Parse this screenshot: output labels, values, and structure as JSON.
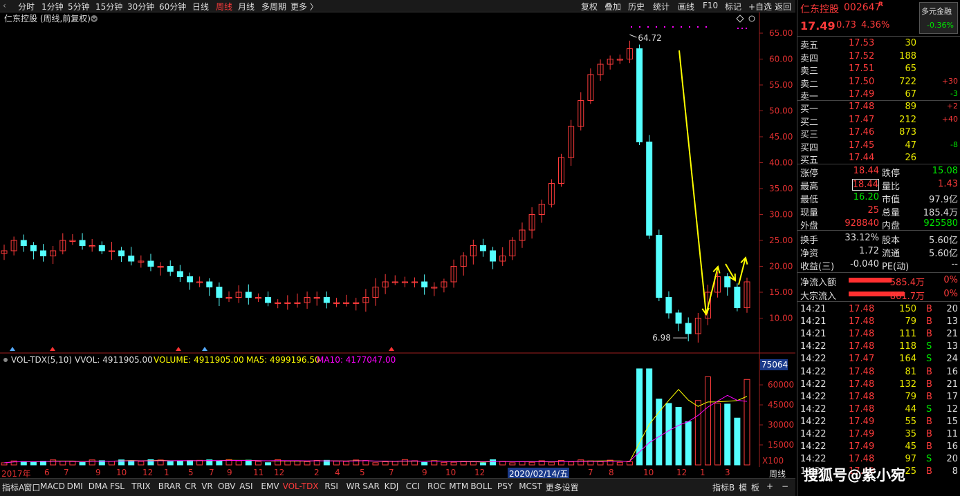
{
  "toolbar": {
    "left": [
      "分时",
      "1分钟",
      "5分钟",
      "15分钟",
      "30分钟",
      "60分钟",
      "日线",
      "周线",
      "月线",
      "多周期",
      "更多 〉"
    ],
    "active": "周线",
    "right": [
      "复权",
      "叠加",
      "历史",
      "统计",
      "画线",
      "F10",
      "标记",
      "+自选",
      "返回"
    ]
  },
  "chart": {
    "title": "仁东控股 (周线,前复权)",
    "high_label": "64.72",
    "low_label": "6.98",
    "price_axis": [
      "65.00",
      "60.00",
      "55.00",
      "50.00",
      "45.00",
      "40.00",
      "35.00",
      "30.00",
      "25.00",
      "20.00",
      "15.00",
      "10.00"
    ],
    "volume_header": {
      "name": "VOL-TDX(5,10)",
      "vvol": "VVOL: 4911905.00",
      "volume": "VOLUME: 4911905.00",
      "ma5": "MA5: 4999196.50",
      "ma10": "MA10: 4177047.00"
    },
    "volume_axis": [
      "75064",
      "60000",
      "45000",
      "30000",
      "15000",
      "X100"
    ],
    "time_axis": [
      "2017年",
      "6",
      "7",
      "9",
      "10",
      "12",
      "1",
      "5",
      "7",
      "9",
      "11",
      "12",
      "2",
      "4",
      "5",
      "7",
      "9",
      "10",
      "12",
      "2020/02/14/五",
      "7",
      "8",
      "10",
      "12",
      "1",
      "3"
    ],
    "time_unit": "周线",
    "colors": {
      "up": "#ff3b3b",
      "down": "#54ffff",
      "ma5": "#ffff00",
      "ma10": "#ff00ff",
      "axis": "#e03030",
      "arrow": "#ffff00"
    }
  },
  "chart_data": {
    "type": "candlestick",
    "title": "仁东控股 (周线,前复权)",
    "period": "weekly",
    "ylim": [
      5,
      67
    ],
    "annotated_high": 64.72,
    "annotated_low": 6.98,
    "close_path": [
      23,
      25,
      24,
      23,
      22,
      23,
      25,
      25,
      24,
      24,
      23,
      23,
      22,
      21,
      21,
      20,
      20,
      19,
      18,
      17,
      17,
      16,
      14,
      14,
      15,
      14,
      14,
      13,
      13,
      13,
      13,
      14,
      14,
      13,
      13,
      13,
      13,
      14,
      16,
      17,
      17,
      17,
      17,
      16,
      16,
      17,
      20,
      22,
      24,
      23,
      21,
      22,
      25,
      27,
      30,
      32,
      36,
      41,
      47,
      52,
      57,
      59,
      60,
      60,
      62,
      44,
      26,
      14,
      11,
      9,
      7,
      10,
      15,
      18,
      16,
      12,
      17
    ],
    "volume_ylim": [
      0,
      75064
    ]
  },
  "stock": {
    "name": "仁东控股",
    "code": "002647",
    "badge": "R",
    "price": "17.49",
    "change": "0.73",
    "pct": "4.36%",
    "button_label": "多元金融",
    "button_pct": "-0.36%"
  },
  "orderbook": {
    "asks": [
      {
        "label": "卖五",
        "price": "17.53",
        "vol": "30",
        "chg": ""
      },
      {
        "label": "卖四",
        "price": "17.52",
        "vol": "188",
        "chg": ""
      },
      {
        "label": "卖三",
        "price": "17.51",
        "vol": "65",
        "chg": ""
      },
      {
        "label": "卖二",
        "price": "17.50",
        "vol": "722",
        "chg": "+30"
      },
      {
        "label": "卖一",
        "price": "17.49",
        "vol": "67",
        "chg": "-3"
      }
    ],
    "bids": [
      {
        "label": "买一",
        "price": "17.48",
        "vol": "89",
        "chg": "+2"
      },
      {
        "label": "买二",
        "price": "17.47",
        "vol": "212",
        "chg": "+40"
      },
      {
        "label": "买三",
        "price": "17.46",
        "vol": "873",
        "chg": ""
      },
      {
        "label": "买四",
        "price": "17.45",
        "vol": "47",
        "chg": "-8"
      },
      {
        "label": "买五",
        "price": "17.44",
        "vol": "26",
        "chg": ""
      }
    ]
  },
  "stats": [
    {
      "l1": "涨停",
      "v1": "18.44",
      "c1": "red",
      "l2": "跌停",
      "v2": "15.08",
      "c2": "green"
    },
    {
      "l1": "最高",
      "v1": "18.44",
      "c1": "red",
      "l2": "量比",
      "v2": "1.43",
      "c2": "red"
    },
    {
      "l1": "最低",
      "v1": "16.20",
      "c1": "green",
      "l2": "市值",
      "v2": "97.9亿",
      "c2": "white"
    },
    {
      "l1": "现量",
      "v1": "25",
      "c1": "red",
      "l2": "总量",
      "v2": "185.4万",
      "c2": "white"
    },
    {
      "l1": "外盘",
      "v1": "928840",
      "c1": "red",
      "l2": "内盘",
      "v2": "925580",
      "c2": "green"
    }
  ],
  "fund": [
    {
      "l1": "换手",
      "v1": "33.12%",
      "l2": "股本",
      "v2": "5.60亿"
    },
    {
      "l1": "净资",
      "v1": "1.72",
      "l2": "流通",
      "v2": "5.60亿"
    },
    {
      "l1": "收益(三)",
      "v1": "-0.040",
      "l2": "PE(动)",
      "v2": "--"
    }
  ],
  "flow": [
    {
      "label": "净流入额",
      "amount": "585.4万",
      "pct": "0%"
    },
    {
      "label": "大宗流入",
      "amount": "861.7万",
      "pct": "0%"
    }
  ],
  "ticks": [
    {
      "t": "14:21",
      "p": "17.48",
      "v": "150",
      "s": "B",
      "n": "20"
    },
    {
      "t": "14:21",
      "p": "17.48",
      "v": "79",
      "s": "B",
      "n": "13"
    },
    {
      "t": "14:21",
      "p": "17.48",
      "v": "111",
      "s": "B",
      "n": "21"
    },
    {
      "t": "14:22",
      "p": "17.48",
      "v": "118",
      "s": "S",
      "n": "13"
    },
    {
      "t": "14:22",
      "p": "17.47",
      "v": "164",
      "s": "S",
      "n": "24"
    },
    {
      "t": "14:22",
      "p": "17.48",
      "v": "81",
      "s": "B",
      "n": "16"
    },
    {
      "t": "14:22",
      "p": "17.48",
      "v": "132",
      "s": "B",
      "n": "21"
    },
    {
      "t": "14:22",
      "p": "17.48",
      "v": "79",
      "s": "B",
      "n": "17"
    },
    {
      "t": "14:22",
      "p": "17.48",
      "v": "44",
      "s": "S",
      "n": "12"
    },
    {
      "t": "14:22",
      "p": "17.49",
      "v": "55",
      "s": "B",
      "n": "15"
    },
    {
      "t": "14:22",
      "p": "17.49",
      "v": "35",
      "s": "B",
      "n": "11"
    },
    {
      "t": "14:22",
      "p": "17.49",
      "v": "45",
      "s": "B",
      "n": "16"
    },
    {
      "t": "14:22",
      "p": "17.48",
      "v": "97",
      "s": "S",
      "n": "20"
    },
    {
      "t": "14:22",
      "p": "17.49",
      "v": "25",
      "s": "B",
      "n": "8"
    }
  ],
  "bottombar": {
    "items": [
      "指标A",
      "窗口",
      "MACD",
      "DMI",
      "DMA",
      "FSL",
      "TRIX",
      "BRAR",
      "CR",
      "VR",
      "OBV",
      "ASI",
      "EMV",
      "VOL-TDX",
      "RSI",
      "WR",
      "SAR",
      "KDJ",
      "CCI",
      "ROC",
      "MTM",
      "BOLL",
      "PSY",
      "MCST",
      "更多",
      "设置"
    ],
    "active": "VOL-TDX",
    "right": [
      "指标B",
      "模",
      "板",
      "+",
      "−"
    ]
  },
  "watermark": "搜狐号@紫小宛"
}
